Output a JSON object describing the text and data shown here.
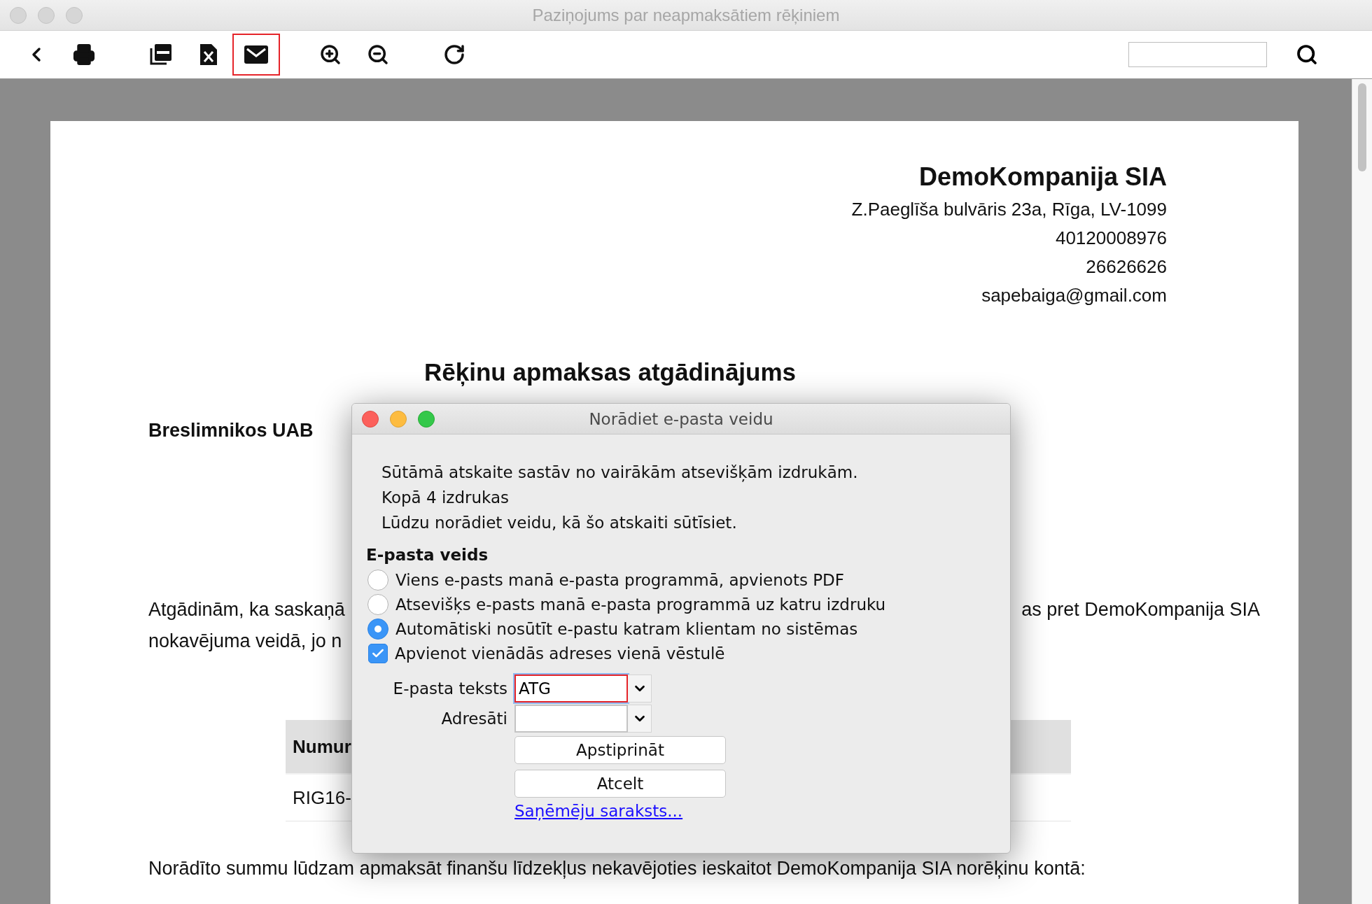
{
  "window": {
    "title": "Paziņojums par neapmaksātiem rēķiniem"
  },
  "toolbar": {
    "buttons": [
      {
        "kind": "back",
        "selected": false
      },
      {
        "kind": "print",
        "selected": false
      },
      {
        "kind": "pdf",
        "selected": false
      },
      {
        "kind": "excel",
        "selected": false
      },
      {
        "kind": "email",
        "selected": true
      },
      {
        "kind": "zoom-in",
        "selected": false
      },
      {
        "kind": "zoom-out",
        "selected": false
      },
      {
        "kind": "refresh",
        "selected": false
      }
    ]
  },
  "document": {
    "company": {
      "name": "DemoKompanija SIA",
      "lines": [
        "Z.Paeglīša bulvāris 23a, Rīga, LV-1099",
        "40120008976",
        "26626626",
        "sapebaiga@gmail.com"
      ]
    },
    "title": "Rēķinu apmaksas atgādinājums",
    "recipient": "Breslimnikos UAB",
    "paragraph_lines": [
      {
        "left": "Atgādinām, ka saskaņā",
        "right": "as pret DemoKompanija SIA"
      },
      {
        "left": "nokavējuma veidā, jo n"
      }
    ],
    "table": {
      "header": "Numur",
      "cell": "RIG16-"
    },
    "footer": "Norādīto summu lūdzam apmaksāt finanšu līdzekļus nekavējoties ieskaitot DemoKompanija SIA norēķinu kontā:"
  },
  "dialog": {
    "title": "Norādiet e-pasta veidu",
    "message_lines": [
      "Sūtāmā atskaite sastāv no vairākām atsevišķām izdrukām.",
      "Kopā 4 izdrukas",
      "Lūdzu norādiet veidu, kā šo atskaiti sūtīsiet."
    ],
    "group_label": "E-pasta veids",
    "options": [
      {
        "label": "Viens e-pasts manā e-pasta programmā, apvienots PDF",
        "selected": false
      },
      {
        "label": "Atsevišķs e-pasts manā e-pasta programmā uz katru izdruku",
        "selected": false
      },
      {
        "label": "Automātiski nosūtīt e-pastu katram klientam no sistēmas",
        "selected": true
      }
    ],
    "merge_option": {
      "label": "Apvienot vienādās adreses vienā vēstulē",
      "checked": true
    },
    "fields": [
      {
        "label": "E-pasta teksts",
        "value": "ATG",
        "focused": true
      },
      {
        "label": "Adresāti",
        "focused": false
      }
    ],
    "buttons": [
      "Apstiprināt",
      "Atcelt"
    ],
    "link": "Saņēmēju saraksts..."
  }
}
